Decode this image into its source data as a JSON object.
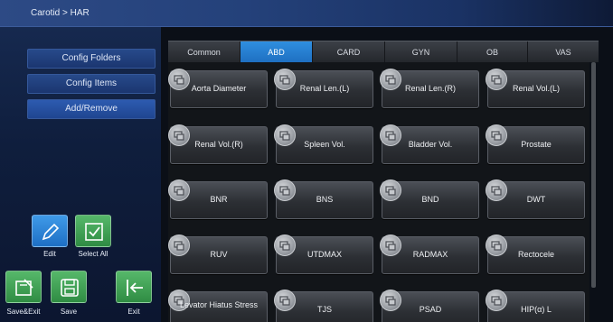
{
  "breadcrumb": "Carotid > HAR",
  "sidebar": {
    "config_folders": "Config Folders",
    "config_items": "Config Items",
    "add_remove": "Add/Remove"
  },
  "toolbar": {
    "edit": "Edit",
    "select_all": "Select All",
    "save_exit": "Save&Exit",
    "save": "Save",
    "exit": "Exit"
  },
  "tabs": [
    "Common",
    "ABD",
    "CARD",
    "GYN",
    "OB",
    "VAS"
  ],
  "active_tab": "ABD",
  "items": [
    "Aorta Diameter",
    "Renal Len.(L)",
    "Renal Len.(R)",
    "Renal Vol.(L)",
    "Renal Vol.(R)",
    "Spleen Vol.",
    "Bladder Vol.",
    "Prostate",
    "BNR",
    "BNS",
    "BND",
    "DWT",
    "RUV",
    "UTDMAX",
    "RADMAX",
    "Rectocele",
    "Levator Hiatus Stress",
    "TJS",
    "PSAD",
    "HIP(α) L"
  ],
  "colors": {
    "accent": "#2f8fe0",
    "sidebar_button": "#1b3670",
    "tool_blue": "#1e6fc4",
    "tool_green": "#2f8c43"
  }
}
